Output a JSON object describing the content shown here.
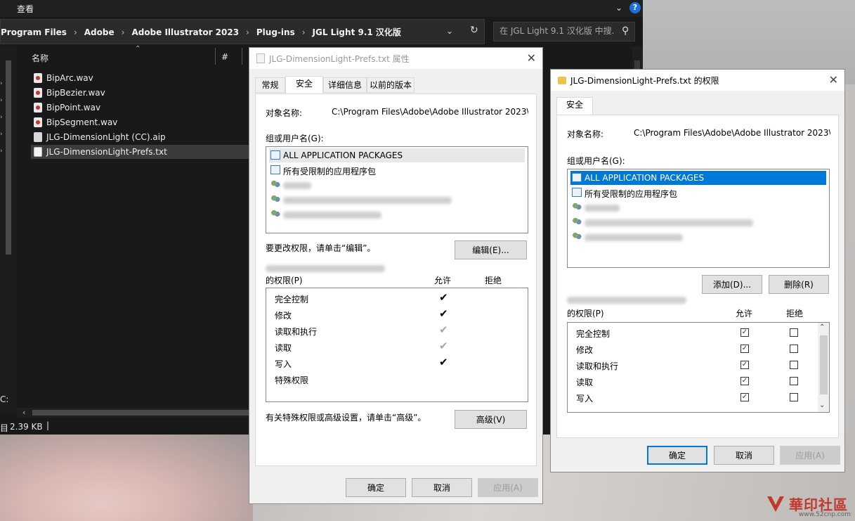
{
  "explorer": {
    "menu_view": "查看",
    "breadcrumbs": [
      "Program Files",
      "Adobe",
      "Adobe Illustrator 2023",
      "Plug-ins",
      "JGL Light 9.1 汉化版"
    ],
    "search_placeholder": "在 JGL Light 9.1 汉化版 中搜...",
    "col_name": "名称",
    "col_hash": "#",
    "files": [
      {
        "name": "BipArc.wav",
        "type": "wav"
      },
      {
        "name": "BipBezier.wav",
        "type": "wav"
      },
      {
        "name": "BipPoint.wav",
        "type": "wav"
      },
      {
        "name": "BipSegment.wav",
        "type": "wav"
      },
      {
        "name": "JLG-DimensionLight (CC).aip",
        "type": "aip"
      },
      {
        "name": "JLG-DimensionLight-Prefs.txt",
        "type": "txt"
      }
    ],
    "nav_letter": "C:",
    "status_left": "目",
    "status_size": "2.39 KB"
  },
  "properties_dialog": {
    "title": "JLG-DimensionLight-Prefs.txt 属性",
    "tabs": [
      "常规",
      "安全",
      "详细信息",
      "以前的版本"
    ],
    "object_label": "对象名称:",
    "object_value": "C:\\Program Files\\Adobe\\Adobe Illustrator 2023\\",
    "group_label": "组或用户名(G):",
    "groups": [
      "ALL APPLICATION PACKAGES",
      "所有受限制的应用程序包"
    ],
    "edit_hint": "要更改权限，请单击“编辑”。",
    "edit_button": "编辑(E)...",
    "perm_label": "的权限(P)",
    "allow_header": "允许",
    "deny_header": "拒绝",
    "perms": [
      "完全控制",
      "修改",
      "读取和执行",
      "读取",
      "写入",
      "特殊权限"
    ],
    "check_mark": "✔",
    "advanced_hint": "有关特殊权限或高级设置，请单击“高级”。",
    "advanced_button": "高级(V)",
    "ok_button": "确定",
    "cancel_button": "取消",
    "apply_button": "应用(A)"
  },
  "permissions_dialog": {
    "title": "JLG-DimensionLight-Prefs.txt 的权限",
    "tab": "安全",
    "object_label": "对象名称:",
    "object_value": "C:\\Program Files\\Adobe\\Adobe Illustrator 2023\\",
    "group_label": "组或用户名(G):",
    "groups": [
      "ALL APPLICATION PACKAGES",
      "所有受限制的应用程序包"
    ],
    "add_button": "添加(D)...",
    "remove_button": "删除(R)",
    "perm_label": "的权限(P)",
    "allow_header": "允许",
    "deny_header": "拒绝",
    "perms": [
      "完全控制",
      "修改",
      "读取和执行",
      "读取",
      "写入"
    ],
    "check_mark": "✓",
    "ok_button": "确定",
    "cancel_button": "取消",
    "apply_button": "应用(A)"
  },
  "watermark": {
    "text": "華印社區",
    "url": "www.52cnp.com"
  },
  "colors": {
    "accent": "#0078d7",
    "explorer_bg": "#191919",
    "dialog_bg": "#f0f0f0"
  }
}
